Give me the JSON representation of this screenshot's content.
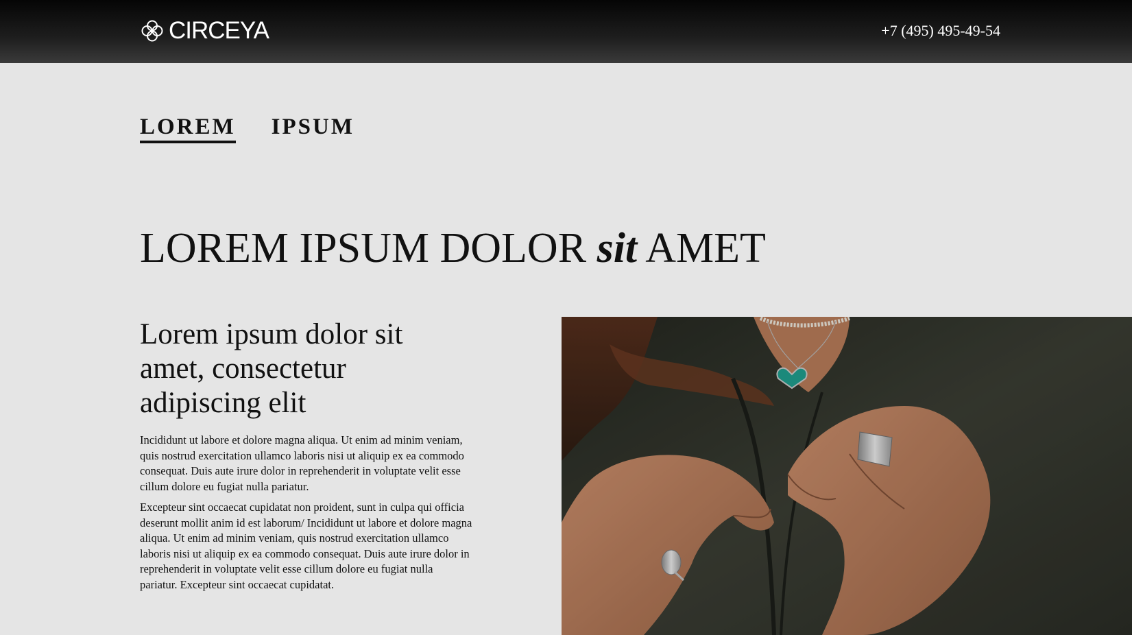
{
  "header": {
    "logo_text": "CIRCEYA",
    "phone": "+7 (495) 495-49-54"
  },
  "tabs": [
    {
      "label": "LOREM",
      "active": true
    },
    {
      "label": "IPSUM",
      "active": false
    }
  ],
  "hero": {
    "part1": "LOREM IPSUM DOLOR",
    "italic": "sit",
    "part2": "AMET"
  },
  "content": {
    "subheading": "Lorem ipsum dolor sit amet, consectetur adipiscing elit",
    "paragraphs": [
      "Incididunt ut labore et dolore magna aliqua. Ut enim ad minim veniam, quis nostrud exercitation ullamco laboris nisi ut aliquip ex ea commodo consequat. Duis aute irure dolor in reprehenderit in voluptate velit esse cillum dolore eu fugiat nulla pariatur.",
      "Excepteur sint occaecat cupidatat non proident, sunt in culpa qui officia deserunt mollit anim id est laborum/ Incididunt ut labore et dolore magna aliqua. Ut enim ad minim veniam, quis nostrud exercitation ullamco laboris nisi ut aliquip ex ea commodo consequat. Duis aute irure dolor in reprehenderit in voluptate velit esse cillum dolore eu fugiat nulla pariatur. Excepteur sint occaecat cupidatat."
    ]
  },
  "photo": {
    "icon": "jewelry-photo"
  },
  "colors": {
    "header_bg": "#111111",
    "page_bg": "#e5e5e5",
    "text": "#111111",
    "accent_teal": "#1a9c8c"
  }
}
